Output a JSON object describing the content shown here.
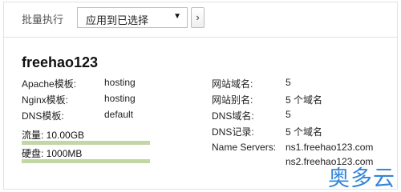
{
  "toolbar": {
    "bulk_label": "批量执行",
    "select_value": "应用到已选择",
    "go_label": "›"
  },
  "domain": {
    "name": "freehao123"
  },
  "left_fields": [
    {
      "label": "Apache模板:",
      "value": "hosting"
    },
    {
      "label": "Nginx模板:",
      "value": "hosting"
    },
    {
      "label": "DNS模板:",
      "value": "default"
    }
  ],
  "usage": {
    "traffic_label": "流量: 10.00GB",
    "disk_label": "硬盘: 1000MB",
    "traffic_fraction": 1.0,
    "disk_fraction": 1.0
  },
  "right_fields": [
    {
      "label": "网站域名:",
      "value": "5"
    },
    {
      "label": "网站别名:",
      "value": "5 个域名"
    },
    {
      "label": "DNS域名:",
      "value": "5"
    },
    {
      "label": "DNS记录:",
      "value": "5 个域名"
    },
    {
      "label": "Name Servers:",
      "value": "ns1.freehao123.com"
    }
  ],
  "name_server_2": "ns2.freehao123.com",
  "watermark": "奥多云",
  "colors": {
    "bar": "#c2d7a3",
    "watermark": "#2a80d8"
  }
}
